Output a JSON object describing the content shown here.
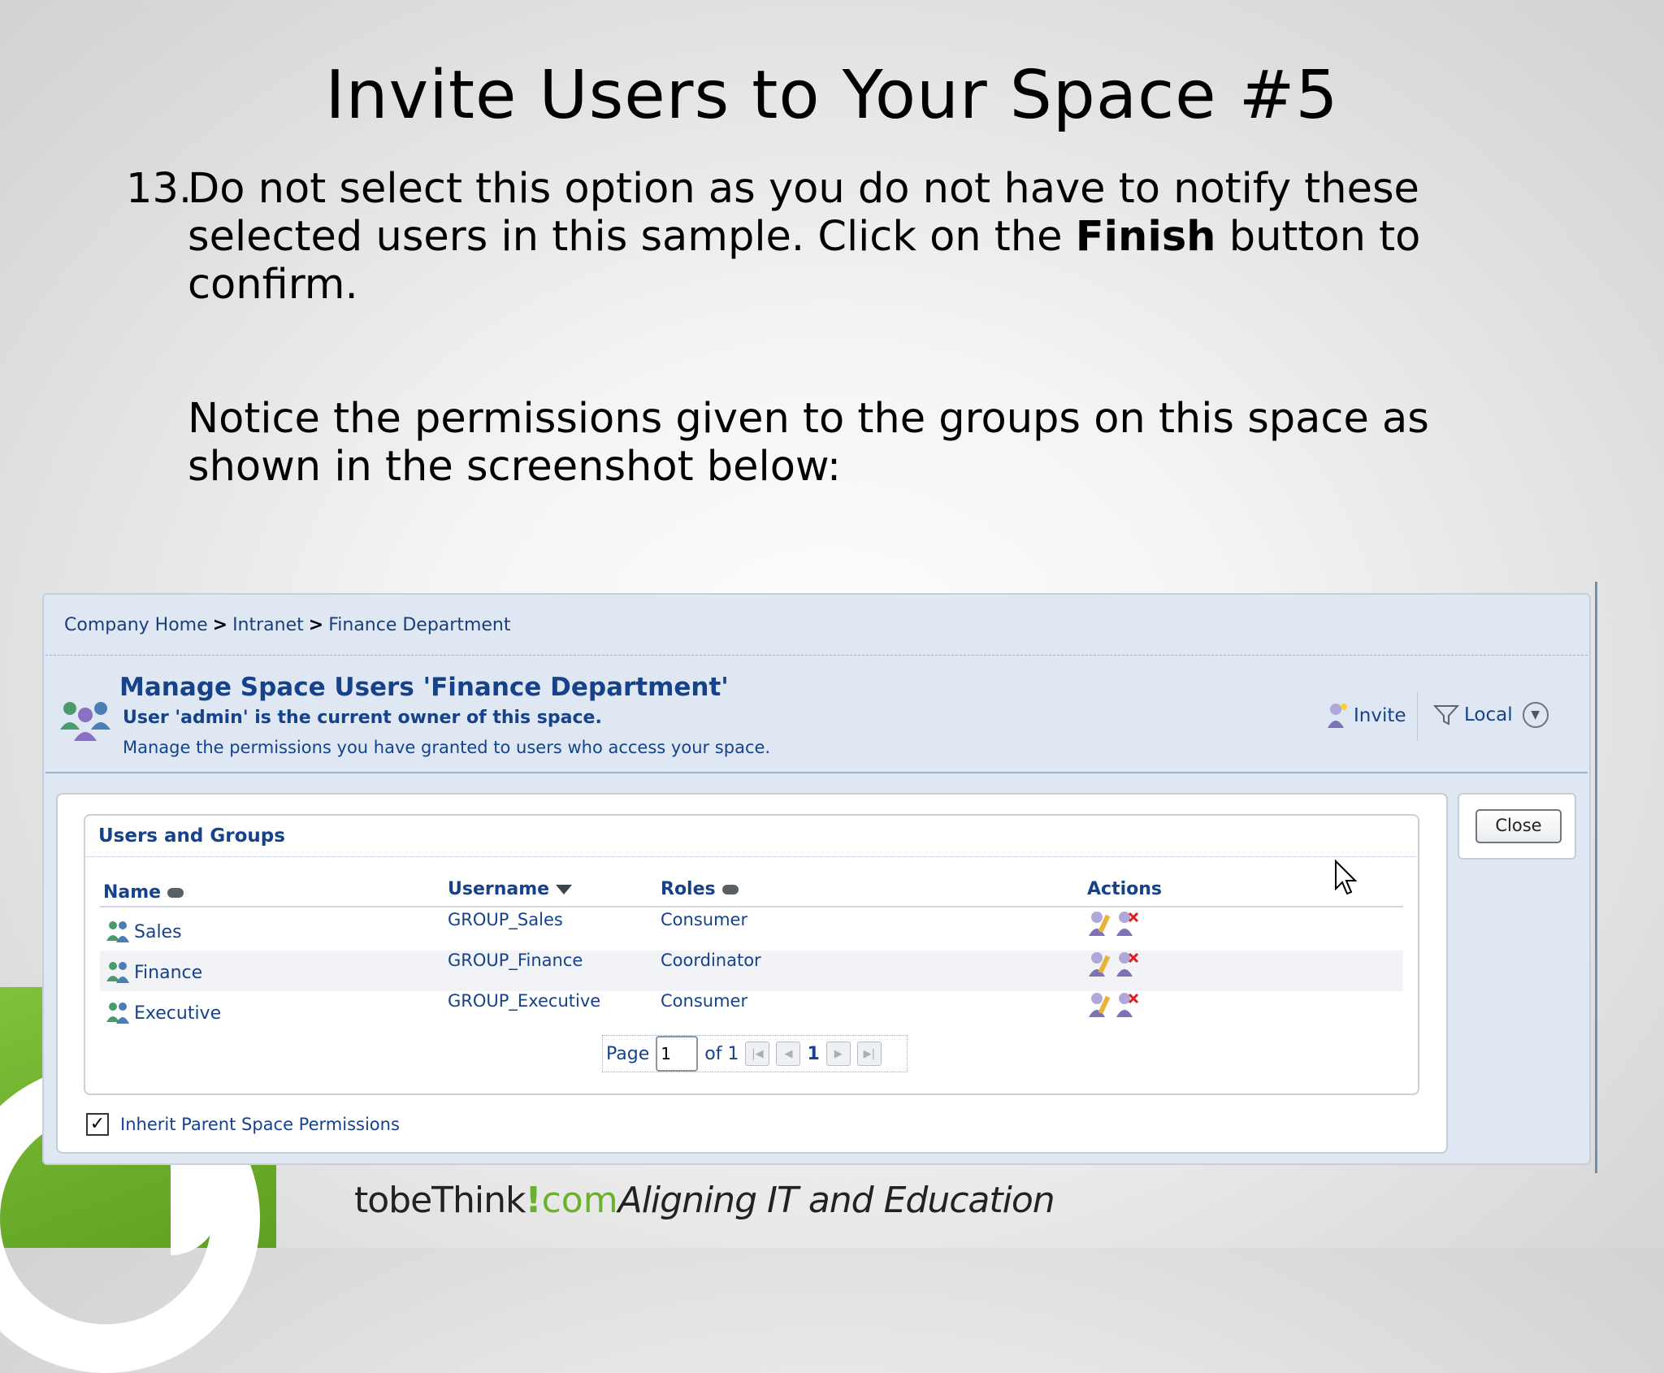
{
  "slide": {
    "title": "Invite Users to Your Space #5",
    "step_number": "13.",
    "step_text_1": "Do not select this option as you do not have to notify these selected users in this sample. Click on the ",
    "step_bold": "Finish",
    "step_text_2": " button to confirm.",
    "notice": "Notice the permissions given to the groups on this space as shown in the screenshot below:"
  },
  "footer": {
    "brand": "tobeThink",
    "bang": "!",
    "com": "com",
    "tagline": "Aligning IT and Education"
  },
  "app": {
    "breadcrumb": [
      "Company Home",
      "Intranet",
      "Finance Department"
    ],
    "breadcrumb_sep": ">",
    "manage_title": "Manage Space Users 'Finance Department'",
    "owner_line": "User 'admin' is the current owner of this space.",
    "description": "Manage the permissions you have granted to users who access your space.",
    "invite_label": "Invite",
    "local_label": "Local",
    "close_label": "Close",
    "panel_title": "Users and Groups",
    "columns": {
      "name": "Name",
      "username": "Username",
      "roles": "Roles",
      "actions": "Actions"
    },
    "rows": [
      {
        "name": "Sales",
        "username": "GROUP_Sales",
        "role": "Consumer"
      },
      {
        "name": "Finance",
        "username": "GROUP_Finance",
        "role": "Coordinator"
      },
      {
        "name": "Executive",
        "username": "GROUP_Executive",
        "role": "Consumer"
      }
    ],
    "pager": {
      "page_label": "Page",
      "page_value": "1",
      "of_label": "of 1",
      "current_page": "1"
    },
    "inherit_label": "Inherit Parent Space Permissions",
    "inherit_checked": true
  },
  "icons": {
    "group": "group-icon",
    "edit_user": "edit-user-icon",
    "remove_user": "remove-user-icon",
    "invite": "invite-user-icon",
    "filter": "filter-icon",
    "first": "first-page-icon",
    "prev": "prev-page-icon",
    "next": "next-page-icon",
    "last": "last-page-icon"
  },
  "colors": {
    "link_blue": "#15428b",
    "brand_green": "#6bb22b"
  }
}
